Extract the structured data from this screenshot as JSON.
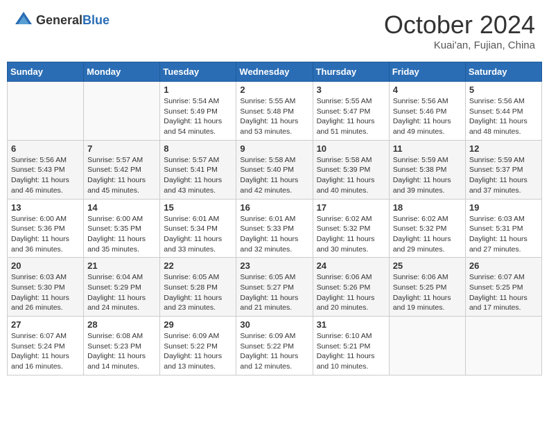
{
  "header": {
    "logo_general": "General",
    "logo_blue": "Blue",
    "month": "October 2024",
    "location": "Kuai'an, Fujian, China"
  },
  "weekdays": [
    "Sunday",
    "Monday",
    "Tuesday",
    "Wednesday",
    "Thursday",
    "Friday",
    "Saturday"
  ],
  "weeks": [
    [
      {
        "day": "",
        "info": ""
      },
      {
        "day": "",
        "info": ""
      },
      {
        "day": "1",
        "info": "Sunrise: 5:54 AM\nSunset: 5:49 PM\nDaylight: 11 hours and 54 minutes."
      },
      {
        "day": "2",
        "info": "Sunrise: 5:55 AM\nSunset: 5:48 PM\nDaylight: 11 hours and 53 minutes."
      },
      {
        "day": "3",
        "info": "Sunrise: 5:55 AM\nSunset: 5:47 PM\nDaylight: 11 hours and 51 minutes."
      },
      {
        "day": "4",
        "info": "Sunrise: 5:56 AM\nSunset: 5:46 PM\nDaylight: 11 hours and 49 minutes."
      },
      {
        "day": "5",
        "info": "Sunrise: 5:56 AM\nSunset: 5:44 PM\nDaylight: 11 hours and 48 minutes."
      }
    ],
    [
      {
        "day": "6",
        "info": "Sunrise: 5:56 AM\nSunset: 5:43 PM\nDaylight: 11 hours and 46 minutes."
      },
      {
        "day": "7",
        "info": "Sunrise: 5:57 AM\nSunset: 5:42 PM\nDaylight: 11 hours and 45 minutes."
      },
      {
        "day": "8",
        "info": "Sunrise: 5:57 AM\nSunset: 5:41 PM\nDaylight: 11 hours and 43 minutes."
      },
      {
        "day": "9",
        "info": "Sunrise: 5:58 AM\nSunset: 5:40 PM\nDaylight: 11 hours and 42 minutes."
      },
      {
        "day": "10",
        "info": "Sunrise: 5:58 AM\nSunset: 5:39 PM\nDaylight: 11 hours and 40 minutes."
      },
      {
        "day": "11",
        "info": "Sunrise: 5:59 AM\nSunset: 5:38 PM\nDaylight: 11 hours and 39 minutes."
      },
      {
        "day": "12",
        "info": "Sunrise: 5:59 AM\nSunset: 5:37 PM\nDaylight: 11 hours and 37 minutes."
      }
    ],
    [
      {
        "day": "13",
        "info": "Sunrise: 6:00 AM\nSunset: 5:36 PM\nDaylight: 11 hours and 36 minutes."
      },
      {
        "day": "14",
        "info": "Sunrise: 6:00 AM\nSunset: 5:35 PM\nDaylight: 11 hours and 35 minutes."
      },
      {
        "day": "15",
        "info": "Sunrise: 6:01 AM\nSunset: 5:34 PM\nDaylight: 11 hours and 33 minutes."
      },
      {
        "day": "16",
        "info": "Sunrise: 6:01 AM\nSunset: 5:33 PM\nDaylight: 11 hours and 32 minutes."
      },
      {
        "day": "17",
        "info": "Sunrise: 6:02 AM\nSunset: 5:32 PM\nDaylight: 11 hours and 30 minutes."
      },
      {
        "day": "18",
        "info": "Sunrise: 6:02 AM\nSunset: 5:32 PM\nDaylight: 11 hours and 29 minutes."
      },
      {
        "day": "19",
        "info": "Sunrise: 6:03 AM\nSunset: 5:31 PM\nDaylight: 11 hours and 27 minutes."
      }
    ],
    [
      {
        "day": "20",
        "info": "Sunrise: 6:03 AM\nSunset: 5:30 PM\nDaylight: 11 hours and 26 minutes."
      },
      {
        "day": "21",
        "info": "Sunrise: 6:04 AM\nSunset: 5:29 PM\nDaylight: 11 hours and 24 minutes."
      },
      {
        "day": "22",
        "info": "Sunrise: 6:05 AM\nSunset: 5:28 PM\nDaylight: 11 hours and 23 minutes."
      },
      {
        "day": "23",
        "info": "Sunrise: 6:05 AM\nSunset: 5:27 PM\nDaylight: 11 hours and 21 minutes."
      },
      {
        "day": "24",
        "info": "Sunrise: 6:06 AM\nSunset: 5:26 PM\nDaylight: 11 hours and 20 minutes."
      },
      {
        "day": "25",
        "info": "Sunrise: 6:06 AM\nSunset: 5:25 PM\nDaylight: 11 hours and 19 minutes."
      },
      {
        "day": "26",
        "info": "Sunrise: 6:07 AM\nSunset: 5:25 PM\nDaylight: 11 hours and 17 minutes."
      }
    ],
    [
      {
        "day": "27",
        "info": "Sunrise: 6:07 AM\nSunset: 5:24 PM\nDaylight: 11 hours and 16 minutes."
      },
      {
        "day": "28",
        "info": "Sunrise: 6:08 AM\nSunset: 5:23 PM\nDaylight: 11 hours and 14 minutes."
      },
      {
        "day": "29",
        "info": "Sunrise: 6:09 AM\nSunset: 5:22 PM\nDaylight: 11 hours and 13 minutes."
      },
      {
        "day": "30",
        "info": "Sunrise: 6:09 AM\nSunset: 5:22 PM\nDaylight: 11 hours and 12 minutes."
      },
      {
        "day": "31",
        "info": "Sunrise: 6:10 AM\nSunset: 5:21 PM\nDaylight: 11 hours and 10 minutes."
      },
      {
        "day": "",
        "info": ""
      },
      {
        "day": "",
        "info": ""
      }
    ]
  ]
}
